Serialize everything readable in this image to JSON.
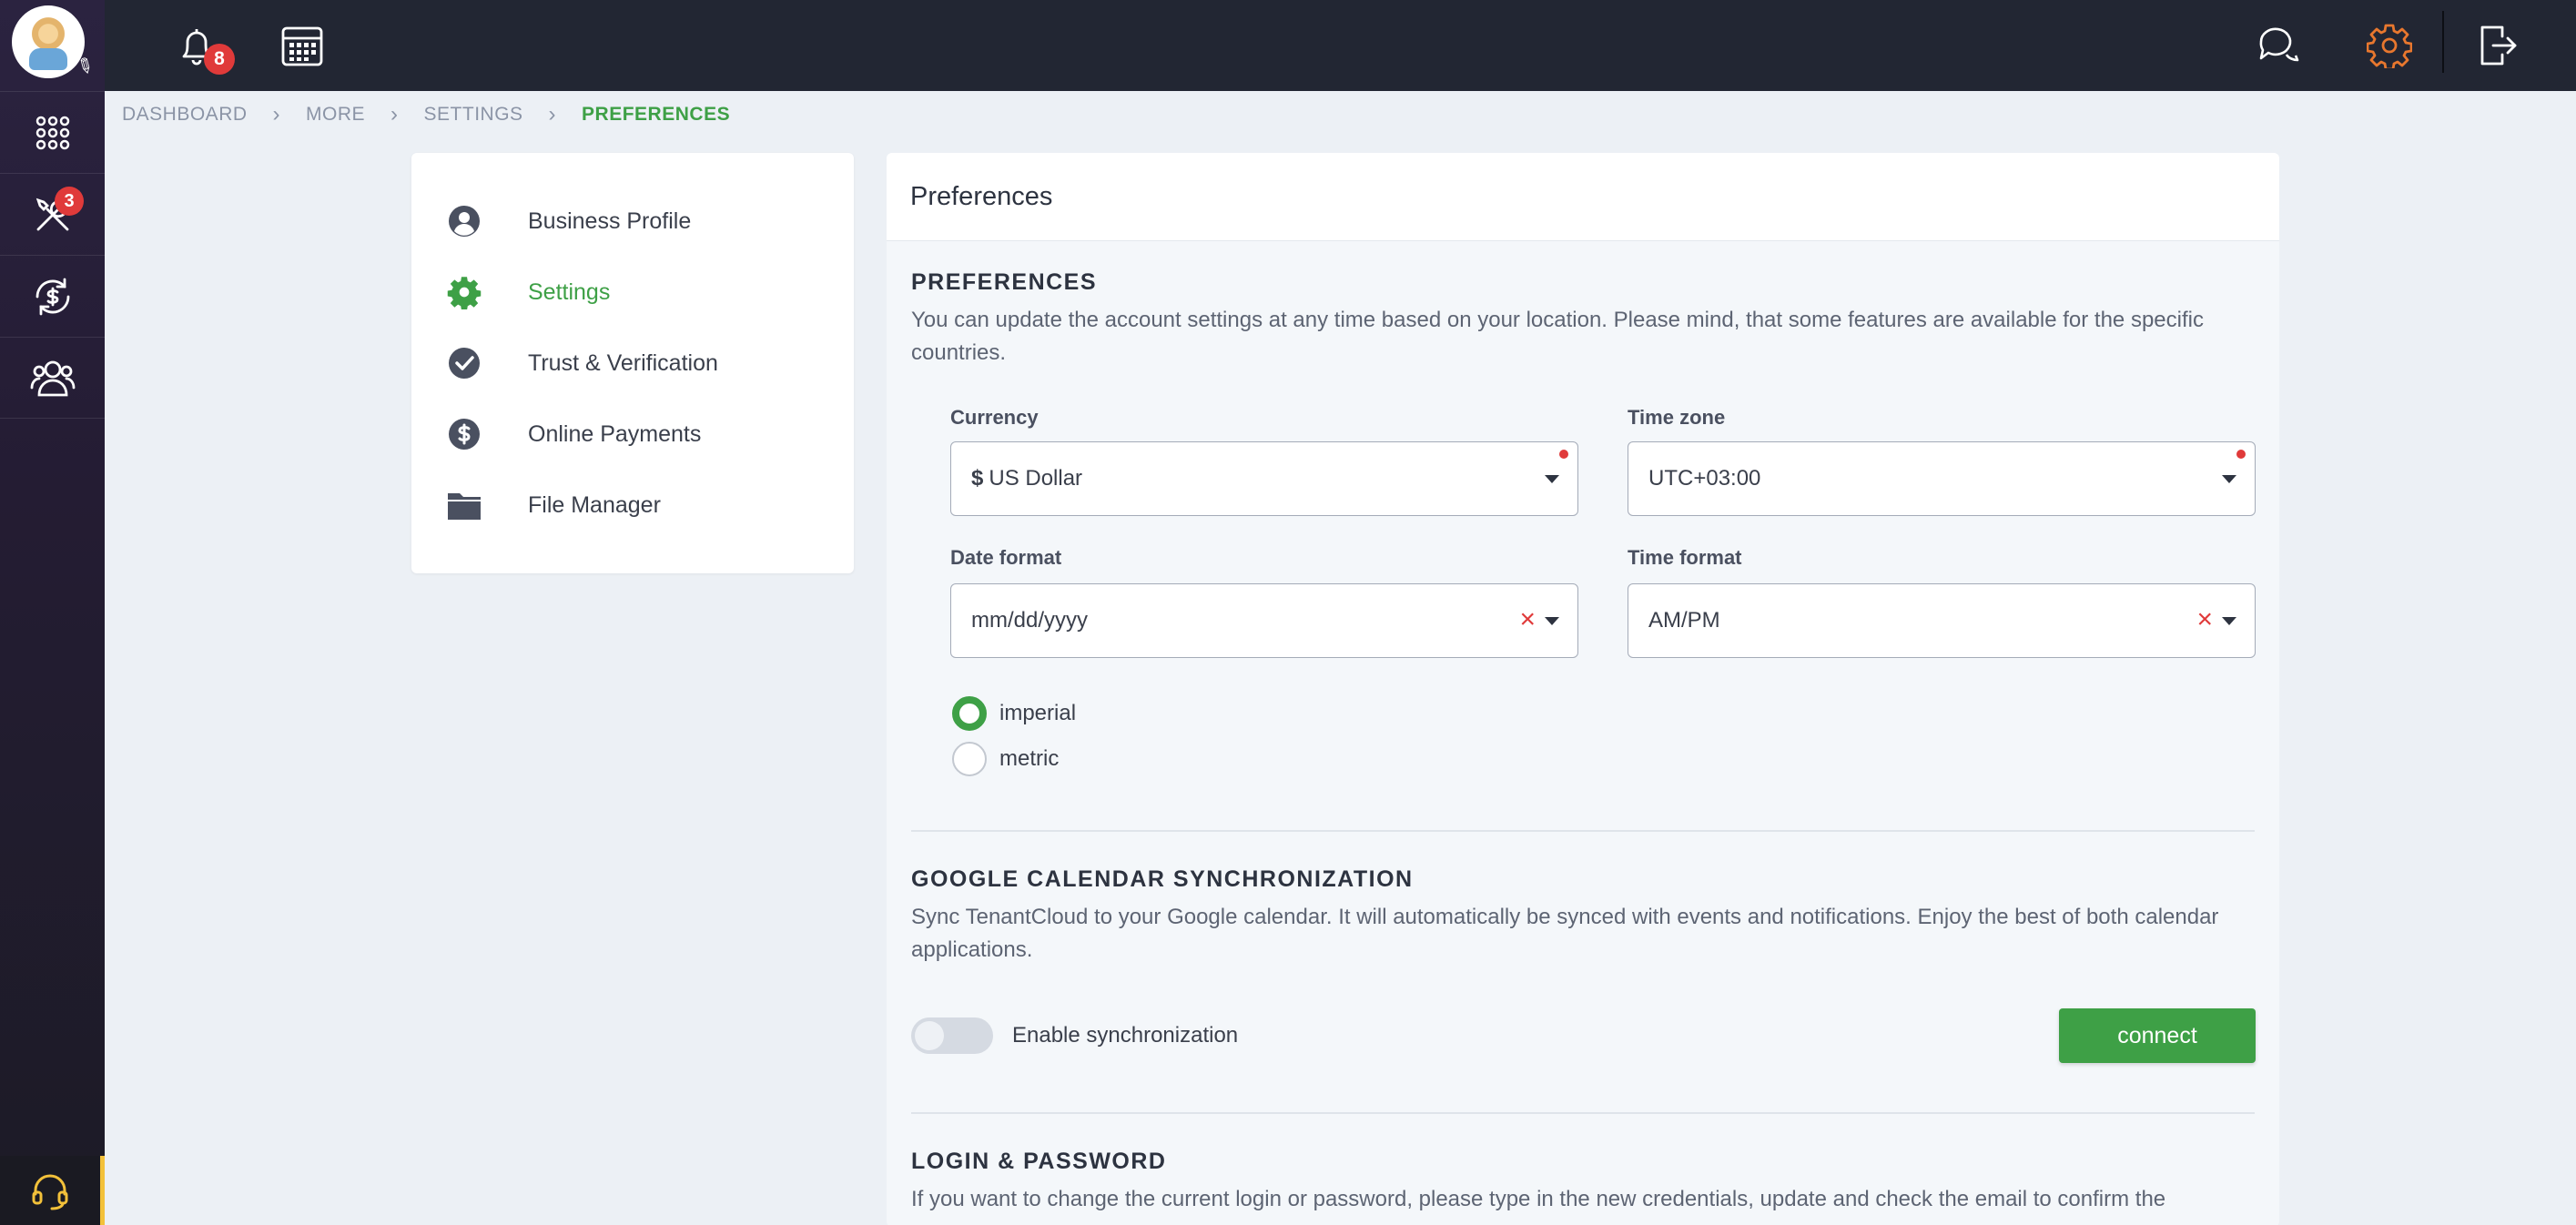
{
  "rail": {
    "tools_badge": "3",
    "items": [
      "apps-grid-icon",
      "tools-icon",
      "money-exchange-icon",
      "users-icon"
    ],
    "support_icon": "headset-icon"
  },
  "topbar": {
    "notifications_badge": "8",
    "icons": [
      "bell-icon",
      "calendar-icon",
      "chat-icon",
      "gear-icon",
      "logout-icon"
    ],
    "active_color": "#e8772e"
  },
  "breadcrumb": [
    "DASHBOARD",
    "MORE",
    "SETTINGS",
    "PREFERENCES"
  ],
  "side_menu": [
    {
      "label": "Business Profile",
      "icon": "user-circle-icon"
    },
    {
      "label": "Settings",
      "icon": "gear-icon",
      "active": true
    },
    {
      "label": "Trust & Verification",
      "icon": "check-circle-icon"
    },
    {
      "label": "Online Payments",
      "icon": "dollar-circle-icon"
    },
    {
      "label": "File Manager",
      "icon": "folder-icon"
    }
  ],
  "main": {
    "title": "Preferences",
    "preferences": {
      "heading": "PREFERENCES",
      "description": "You can update the account settings at any time based on your location. Please mind, that some features are available for the specific countries.",
      "currency_label": "Currency",
      "currency_symbol": "$",
      "currency_value": "US Dollar",
      "timezone_label": "Time zone",
      "timezone_value": "UTC+03:00",
      "date_format_label": "Date format",
      "date_format_value": "mm/dd/yyyy",
      "time_format_label": "Time format",
      "time_format_value": "AM/PM",
      "units": [
        {
          "label": "imperial",
          "selected": true
        },
        {
          "label": "metric",
          "selected": false
        }
      ]
    },
    "google_calendar": {
      "heading": "GOOGLE CALENDAR SYNCHRONIZATION",
      "description": "Sync TenantCloud to your Google calendar. It will automatically be synced with events and notifications. Enjoy the best of both calendar applications.",
      "toggle_label": "Enable synchronization",
      "toggle_on": false,
      "connect_label": "connect"
    },
    "login_password": {
      "heading": "LOGIN & PASSWORD",
      "description": "If you want to change the current login or password, please type in the new credentials, update and check the email to confirm the"
    }
  },
  "colors": {
    "accent": "#3ea046",
    "danger": "#e03a3a",
    "topbar": "#222633"
  }
}
